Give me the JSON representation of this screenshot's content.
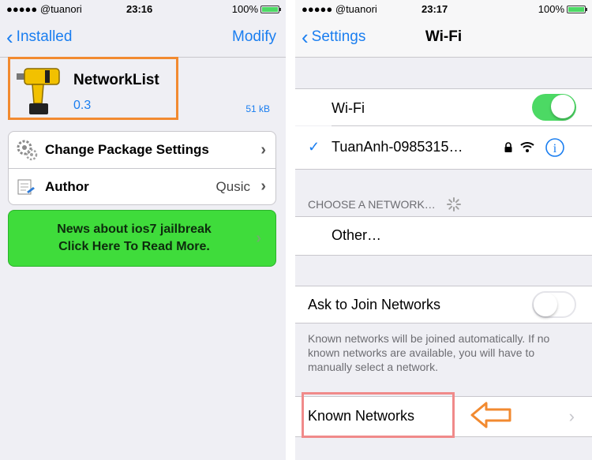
{
  "left_screen": {
    "status": {
      "carrier": "●●●●● @tuanori",
      "time": "23:16",
      "battery": "100%",
      "battery_level": 1.0
    },
    "nav": {
      "back_label": "Installed",
      "right_label": "Modify"
    },
    "package": {
      "name": "NetworkList",
      "version": "0.3",
      "size": "51 kB",
      "icon": "drill-icon"
    },
    "rows": [
      {
        "label": "Change Package Settings",
        "value": "",
        "icon": "gears-icon"
      },
      {
        "label": "Author",
        "value": "Qusic",
        "icon": "author-icon"
      }
    ],
    "news": {
      "line1": "News about ios7 jailbreak",
      "line2": "Click Here To Read More.",
      "color": "#3fdc3b"
    },
    "highlight_color": "#f28a30"
  },
  "right_screen": {
    "status": {
      "carrier": "●●●●● @tuanori",
      "time": "23:17",
      "battery": "100%",
      "battery_level": 1.0
    },
    "nav": {
      "back_label": "Settings",
      "title": "Wi-Fi"
    },
    "wifi": {
      "label": "Wi-Fi",
      "on": true
    },
    "connected_network": {
      "name": "TuanAnh-0985315…",
      "locked": true,
      "icons": [
        "lock-icon",
        "wifi-signal-icon",
        "info-icon"
      ]
    },
    "choose_header": "CHOOSE A NETWORK…",
    "other_label": "Other…",
    "ask_to_join": {
      "label": "Ask to Join Networks",
      "on": false
    },
    "footer": "Known networks will be joined automatically. If no known networks are available, you will have to manually select a network.",
    "known_networks": {
      "label": "Known Networks"
    },
    "accent_color": "#1a7ef0",
    "toggle_on_color": "#4cd964",
    "highlight_color": "#f08a8a",
    "arrow_color": "#f28a30"
  }
}
